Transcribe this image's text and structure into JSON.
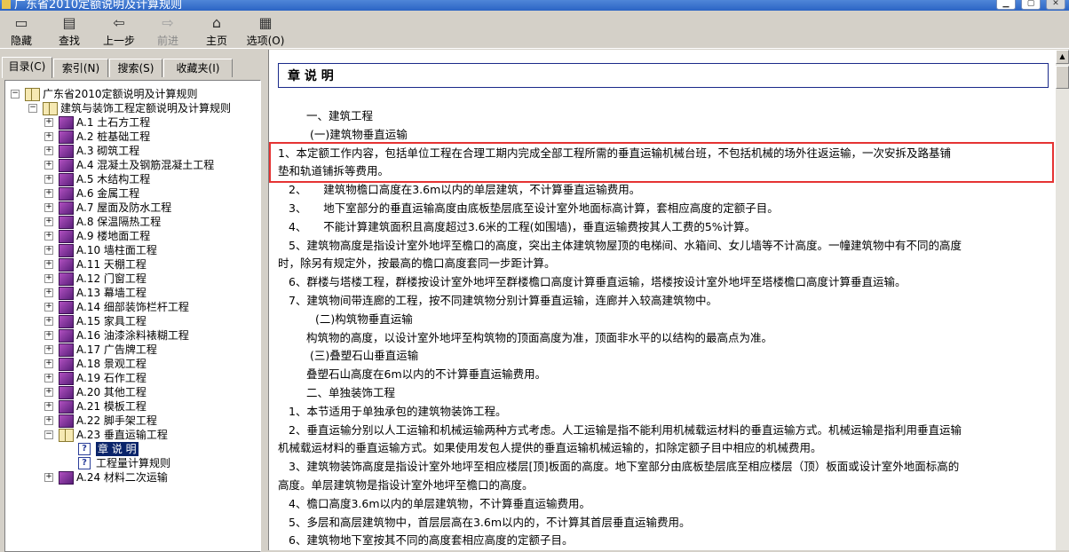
{
  "window": {
    "title": "广东省2010定额说明及计算规则"
  },
  "toolbar": {
    "hide": "隐藏",
    "find": "查找",
    "back": "上一步",
    "forward": "前进",
    "home": "主页",
    "options": "选项(O)"
  },
  "tabs": [
    "目录(C)",
    "索引(N)",
    "搜索(S)",
    "收藏夹(I)"
  ],
  "tree": {
    "root": "广东省2010定额说明及计算规则",
    "sub": "建筑与装饰工程定额说明及计算规则",
    "items": [
      "A.1 土石方工程",
      "A.2 桩基础工程",
      "A.3 砌筑工程",
      "A.4 混凝土及钢筋混凝土工程",
      "A.5 木结构工程",
      "A.6 金属工程",
      "A.7 屋面及防水工程",
      "A.8 保温隔热工程",
      "A.9 楼地面工程",
      "A.10 墙柱面工程",
      "A.11 天棚工程",
      "A.12 门窗工程",
      "A.13 幕墙工程",
      "A.14 细部装饰栏杆工程",
      "A.15 家具工程",
      "A.16 油漆涂料裱糊工程",
      "A.17 广告牌工程",
      "A.18 景观工程",
      "A.19 石作工程",
      "A.20 其他工程",
      "A.21 模板工程",
      "A.22 脚手架工程",
      "A.23 垂直运输工程"
    ],
    "children": [
      "章 说 明",
      "工程量计算规则"
    ],
    "last": "A.24 材料二次运输"
  },
  "content": {
    "title": "章 说 明",
    "lines": [
      "一、建筑工程",
      "(一)建筑物垂直运输",
      "1、本定额工作内容，包括单位工程在合理工期内完成全部工程所需的垂直运输机械台班，不包括机械的场外往返运输，一次安拆及路基铺",
      "垫和轨道铺拆等费用。",
      "2、　　建筑物檐口高度在3.6m以内的单层建筑，不计算垂直运输费用。",
      "3、　　地下室部分的垂直运输高度由底板垫层底至设计室外地面标高计算，套相应高度的定额子目。",
      "4、　　不能计算建筑面积且高度超过3.6米的工程(如围墙)，垂直运输费按其人工费的5%计算。",
      "5、建筑物高度是指设计室外地坪至檐口的高度，突出主体建筑物屋顶的电梯间、水箱间、女儿墙等不计高度。一幢建筑物中有不同的高度",
      "时，除另有规定外，按最高的檐口高度套同一步距计算。",
      "6、群楼与塔楼工程，群楼按设计室外地坪至群楼檐口高度计算垂直运输，塔楼按设计室外地坪至塔楼檐口高度计算垂直运输。",
      "7、建筑物间带连廊的工程，按不同建筑物分别计算垂直运输，连廊并入较高建筑物中。",
      "(二)构筑物垂直运输",
      "构筑物的高度，以设计室外地坪至构筑物的顶面高度为准，顶面非水平的以结构的最高点为准。",
      "(三)叠塑石山垂直运输",
      "叠塑石山高度在6m以内的不计算垂直运输费用。",
      "二、单独装饰工程",
      "1、本节适用于单独承包的建筑物装饰工程。",
      "2、垂直运输分别以人工运输和机械运输两种方式考虑。人工运输是指不能利用机械载运材料的垂直运输方式。机械运输是指利用垂直运输",
      "机械载运材料的垂直运输方式。如果使用发包人提供的垂直运输机械运输的，扣除定额子目中相应的机械费用。",
      "3、建筑物装饰高度是指设计室外地坪至相应楼层[顶]板面的高度。地下室部分由底板垫层底至相应楼层（顶）板面或设计室外地面标高的",
      "高度。单层建筑物是指设计室外地坪至檐口的高度。",
      "4、檐口高度3.6m以内的单层建筑物，不计算垂直运输费用。",
      "5、多层和高层建筑物中，首层层高在3.6m以内的，不计算其首层垂直运输费用。",
      "6、建筑物地下室按其不同的高度套相应高度的定额子目。"
    ]
  }
}
